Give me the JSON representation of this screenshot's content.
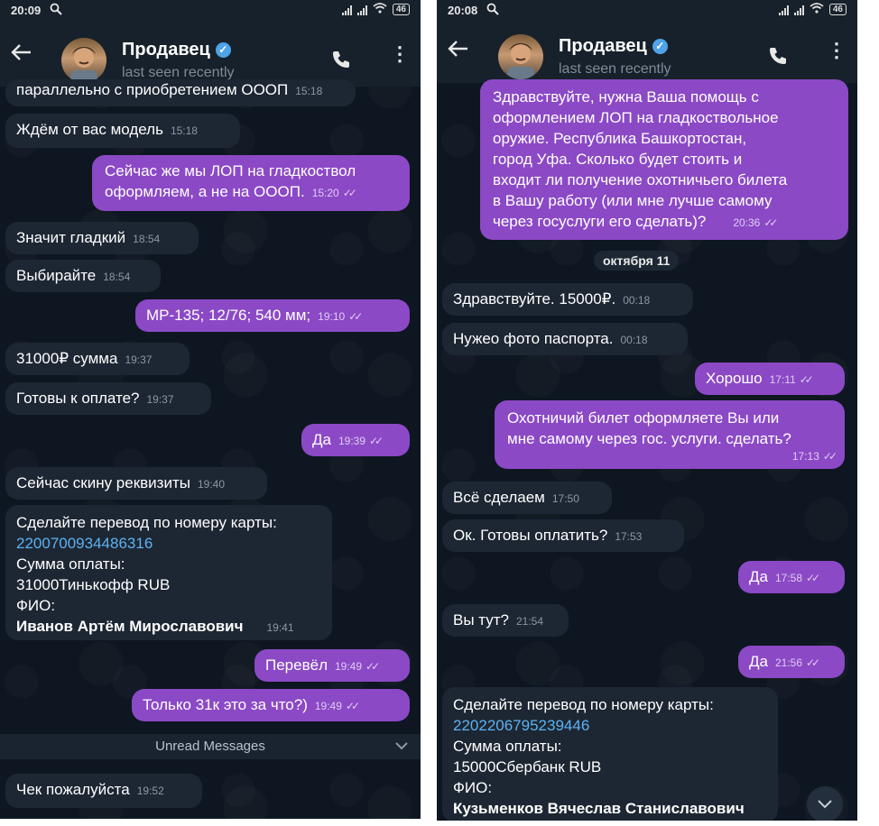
{
  "left": {
    "status_time": "20:09",
    "battery": "46",
    "contact_name": "Продавец",
    "last_seen": "last seen recently",
    "messages": [
      {
        "text": "параллельно с приобретением ОООП",
        "time": "15:18"
      },
      {
        "text": "Ждём от вас модель",
        "time": "15:18"
      },
      {
        "line1": "Сейчас же мы ЛОП на гладкоствол",
        "line2": "оформляем, а не на ОООП.",
        "time": "15:20"
      },
      {
        "text": "Значит гладкий",
        "time": "18:54"
      },
      {
        "text": "Выбирайте",
        "time": "18:54"
      },
      {
        "text": "МР-135; 12/76; 540 мм;",
        "time": "19:10"
      },
      {
        "text": "31000₽ сумма",
        "time": "19:37"
      },
      {
        "text": "Готовы к оплате?",
        "time": "19:37"
      },
      {
        "text": "Да",
        "time": "19:39"
      },
      {
        "text": "Сейчас скину реквизиты",
        "time": "19:40"
      },
      {
        "line1": "Сделайте перевод по номеру карты:",
        "card": "2200700934486316",
        "line3": "Сумма оплаты:",
        "line4": "31000Тинькофф RUB",
        "line5": "ФИО:",
        "line6": "Иванов Артём Мирославович",
        "time": "19:41"
      },
      {
        "text": "Перевёл",
        "time": "19:49"
      },
      {
        "text": "Только 31к это за что?)",
        "time": "19:49"
      },
      {
        "text": "Чек пожалуйста",
        "time": "19:52"
      }
    ],
    "unread_label": "Unread Messages"
  },
  "right": {
    "status_time": "20:08",
    "battery": "46",
    "contact_name": "Продавец",
    "last_seen": "last seen recently",
    "date_divider": "октября 11",
    "messages": [
      {
        "l1": "Здравствуйте, нужна Ваша помощь с",
        "l2": "оформлением ЛОП на гладкоствольное",
        "l3": "оружие. Республика Башкортостан,",
        "l4": "город Уфа. Сколько будет стоить и",
        "l5": "входит ли получение охотничьего билета",
        "l6": "в Вашу работу (или мне лучше самому",
        "l7": "через госуслуги его сделать)?",
        "time": "20:36"
      },
      {
        "text": "Здравствуйте. 15000₽.",
        "time": "00:18"
      },
      {
        "text": "Нужео фото паспорта.",
        "time": "00:18"
      },
      {
        "text": "Хорошо",
        "time": "17:11"
      },
      {
        "line1": "Охотничий билет оформляете Вы или",
        "line2": "мне самому через гос. услуги. сделать?",
        "time": "17:13"
      },
      {
        "text": "Всё сделаем",
        "time": "17:50"
      },
      {
        "text": "Ок. Готовы оплатить?",
        "time": "17:53"
      },
      {
        "text": "Да",
        "time": "17:58"
      },
      {
        "text": "Вы тут?",
        "time": "21:54"
      },
      {
        "text": "Да",
        "time": "21:56"
      },
      {
        "line1": "Сделайте перевод по номеру карты:",
        "card": "2202206795239446",
        "line3": "Сумма оплаты:",
        "line4": "15000Сбербанк RUB",
        "line5": "ФИО:",
        "line6": "Кузьменков Вячеслав Станиславович"
      }
    ]
  },
  "icons": {
    "search": "search-icon",
    "signal": "signal-icon",
    "wifi": "wifi-icon",
    "battery": "battery-icon",
    "back": "back-arrow-icon",
    "verified": "verified-badge-icon",
    "call": "phone-call-icon",
    "more": "more-vertical-icon",
    "ticks": "double-check-icon",
    "chevron": "chevron-down-icon"
  },
  "colors": {
    "background": "#0e1621",
    "header": "#17212b",
    "incoming": "#1d2733",
    "outgoing": "#8b49c6",
    "link": "#5cb2f2"
  }
}
